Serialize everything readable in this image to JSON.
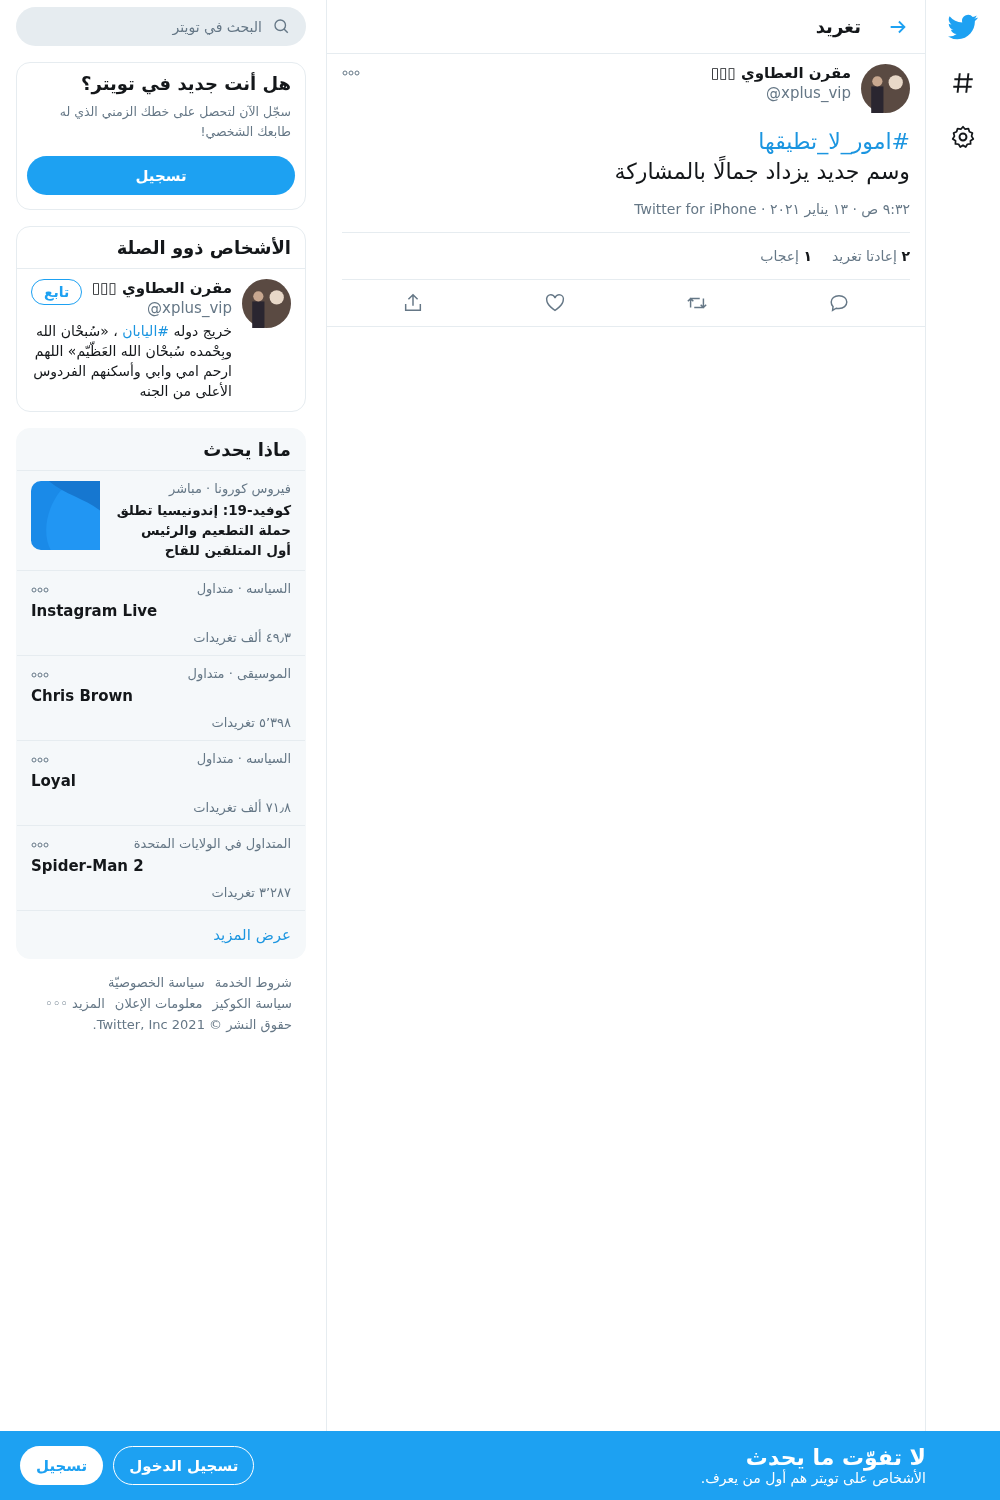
{
  "header": {
    "title": "تغريد"
  },
  "nav": [
    {
      "kind": "bird"
    },
    {
      "kind": "hash"
    },
    {
      "kind": "gear"
    }
  ],
  "tweet": {
    "name": "مقرن العطاوي ▯▯▯",
    "handle": "@xplus_vip",
    "hashtag": "#امور_لا_تطيقها",
    "text": "وسم جديد يزداد جمالًا بالمشاركة",
    "meta": "٩:٣٢ ص · ١٣ يناير ٢٠٢١ · Twitter for iPhone",
    "stats": [
      {
        "count": "٢",
        "label": "إعادتا تغريد"
      },
      {
        "count": "١",
        "label": "إعجاب"
      }
    ],
    "actions": [
      {
        "kind": "reply"
      },
      {
        "kind": "retweet"
      },
      {
        "kind": "like"
      },
      {
        "kind": "share"
      }
    ]
  },
  "search": {
    "placeholder": "البحث في تويتر"
  },
  "signup_card": {
    "title": "هل أنت جديد في تويتر؟",
    "text": "سجّل الآن لتحصل على خطك الزمني الذي له طابعك الشخصي!",
    "button": "تسجيل"
  },
  "related": {
    "title": "الأشخاص ذوو الصلة",
    "name": "مقرن العطاوي ▯▯▯",
    "handle": "@xplus_vip",
    "follow": "تابع",
    "bio": [
      {
        "text": "خريج دوله "
      },
      {
        "text": "#اليابان",
        "link": true
      },
      {
        "text": " ، «سُبحْان الله وبِحْمده سُبحْان الله العَظّيّم» اللهم ارحم امي وابي وأسكنهم الفردوس الأعلى من الجنه"
      }
    ]
  },
  "trends": {
    "title": "ماذا يحدث",
    "news": {
      "context": "فيروس كورونا · مباشر",
      "headline": "كوفيد-19: إندونيسيا تطلق حملة التطعيم والرئيس أول المتلقين للقاح"
    },
    "items": [
      {
        "context": "السياسه · متداول",
        "name": "Instagram Live",
        "count": "٤٩٫٣ ألف تغريدات"
      },
      {
        "context": "الموسيقى · متداول",
        "name": "Chris Brown",
        "count": "٥٬٣٩٨ تغريدات"
      },
      {
        "context": "السياسه · متداول",
        "name": "Loyal",
        "count": "٧١٫٨ ألف تغريدات"
      },
      {
        "context": "المتداول في الولايات المتحدة",
        "name": "Spider-Man 2",
        "count": "٣٬٢٨٧ تغريدات"
      }
    ],
    "more": "عرض المزيد"
  },
  "footer": {
    "links": [
      [
        "شروط الخدمة",
        "سياسة الخصوصيّة"
      ],
      [
        "سياسة الكوكيز",
        "معلومات الإعلان",
        "المزيد ◦◦◦"
      ]
    ],
    "copyright": "حقوق النشر © 2021 Twitter, Inc."
  },
  "bottom_bar": {
    "title": "لا تفوّت ما يحدث",
    "subtitle": "الأشخاص على تويتر هم أول من يعرف.",
    "login": "تسجيل الدخول",
    "signup": "تسجيل"
  }
}
